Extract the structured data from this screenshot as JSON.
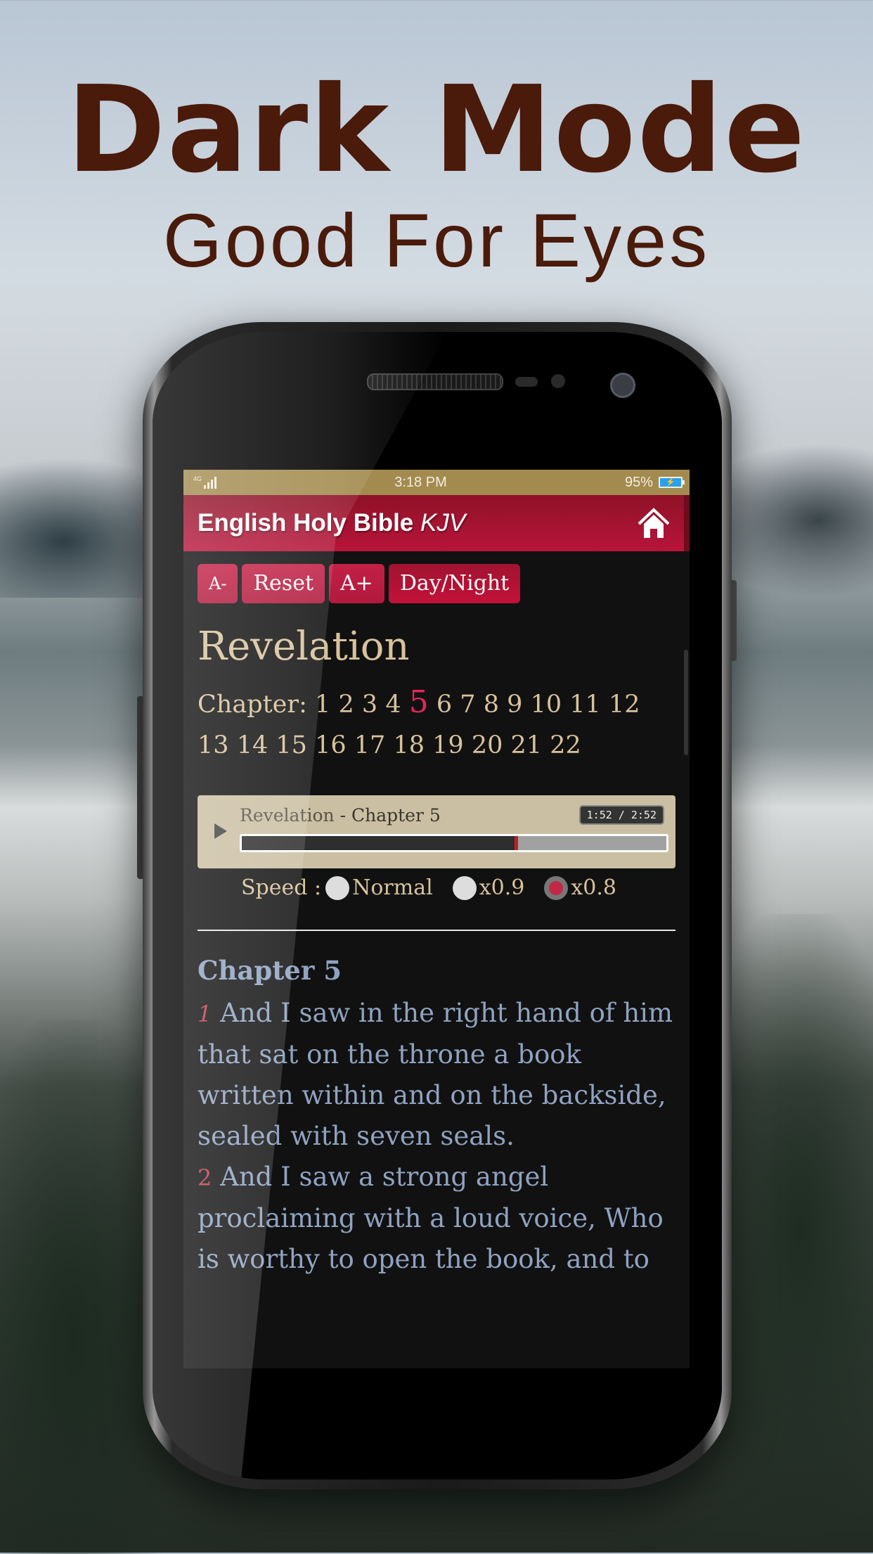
{
  "promo": {
    "title": "Dark Mode",
    "subtitle": "Good For Eyes"
  },
  "status_bar": {
    "network": "4G",
    "time": "3:18 PM",
    "battery_percent": "95%",
    "battery_icon": "battery-charging-icon",
    "signal_icon": "signal-bars-icon"
  },
  "app_bar": {
    "title": "English Holy Bible",
    "version": "KJV",
    "home_icon": "home-icon"
  },
  "toolbar": {
    "decrease_font_label": "A-",
    "reset_label": "Reset",
    "increase_font_label": "A+",
    "day_night_label": "Day/Night"
  },
  "book": {
    "title": "Revelation",
    "chapter_label": "Chapter:",
    "chapters": [
      "1",
      "2",
      "3",
      "4",
      "5",
      "6",
      "7",
      "8",
      "9",
      "10",
      "11",
      "12",
      "13",
      "14",
      "15",
      "16",
      "17",
      "18",
      "19",
      "20",
      "21",
      "22"
    ],
    "active_chapter": "5"
  },
  "player": {
    "book": "Revelation",
    "separator": " - ",
    "chapter": "Chapter 5",
    "time_display": "1:52 / 2:52",
    "progress_fraction": 0.651,
    "play_icon": "play-icon"
  },
  "speed": {
    "label": "Speed :",
    "options": [
      {
        "label": "Normal",
        "selected": false
      },
      {
        "label": "x0.9",
        "selected": false
      },
      {
        "label": "x0.8",
        "selected": true
      }
    ]
  },
  "reading": {
    "chapter_heading": "Chapter 5",
    "verses": [
      {
        "num": "1",
        "text": "And I saw in the right hand of him that sat on the throne a book written within and on the backside, sealed with seven seals."
      },
      {
        "num": "2",
        "text": "And I saw a strong angel proclaiming with a loud voice, Who is worthy to open the book, and to"
      }
    ]
  },
  "colors": {
    "accent": "#b8143a",
    "status_bar": "#a38b4f",
    "heading_text": "#d8c29b",
    "verse_text": "#8fa2c1",
    "active_chapter": "#e2275a",
    "verse_number": "#c23d52"
  }
}
